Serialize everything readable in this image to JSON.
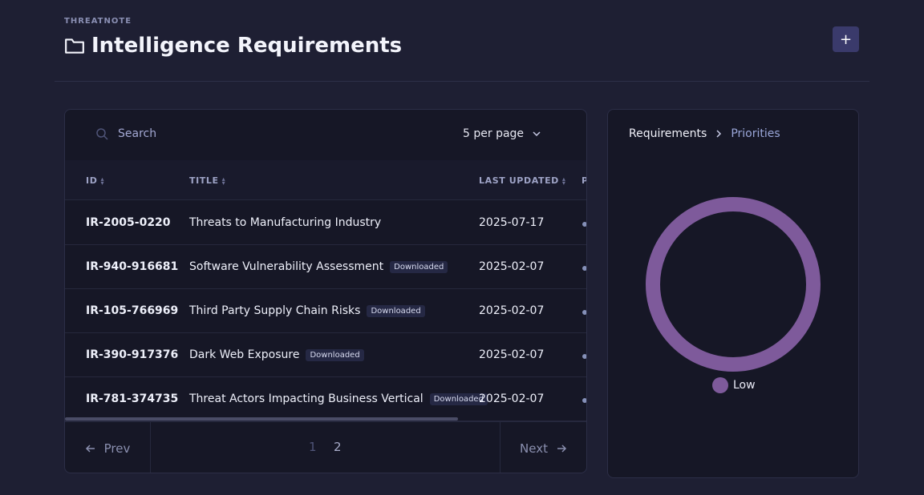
{
  "header": {
    "app_label": "THREATNOTE",
    "title": "Intelligence Requirements",
    "add_label": "+"
  },
  "table": {
    "search_placeholder": "Search",
    "per_page": "5 per page",
    "columns": [
      "ID",
      "TITLE",
      "LAST UPDATED",
      "P"
    ],
    "rows": [
      {
        "id": "IR-2005-0220",
        "title": "Threats to Manufacturing Industry",
        "badge": "",
        "updated": "2025-07-17"
      },
      {
        "id": "IR-940-916681",
        "title": "Software Vulnerability Assessment",
        "badge": "Downloaded",
        "updated": "2025-02-07"
      },
      {
        "id": "IR-105-766969",
        "title": "Third Party Supply Chain Risks",
        "badge": "Downloaded",
        "updated": "2025-02-07"
      },
      {
        "id": "IR-390-917376",
        "title": "Dark Web Exposure",
        "badge": "Downloaded",
        "updated": "2025-02-07"
      },
      {
        "id": "IR-781-374735",
        "title": "Threat Actors Impacting Business Vertical",
        "badge": "Downloaded",
        "updated": "2025-02-07"
      }
    ],
    "pagination": {
      "prev": "Prev",
      "next": "Next",
      "pages": [
        "1",
        "2"
      ],
      "current": "2"
    }
  },
  "chart_panel": {
    "breadcrumb": [
      "Requirements",
      "Priorities"
    ]
  },
  "chart_data": {
    "type": "pie",
    "categories": [
      "Low"
    ],
    "values": [
      5
    ],
    "colors": [
      "#7e5a9b"
    ],
    "legend": "bottom"
  },
  "colors": {
    "background": "#1e1f33",
    "card": "#161726",
    "accent": "#3a3a6b",
    "donut": "#7e5a9b"
  }
}
